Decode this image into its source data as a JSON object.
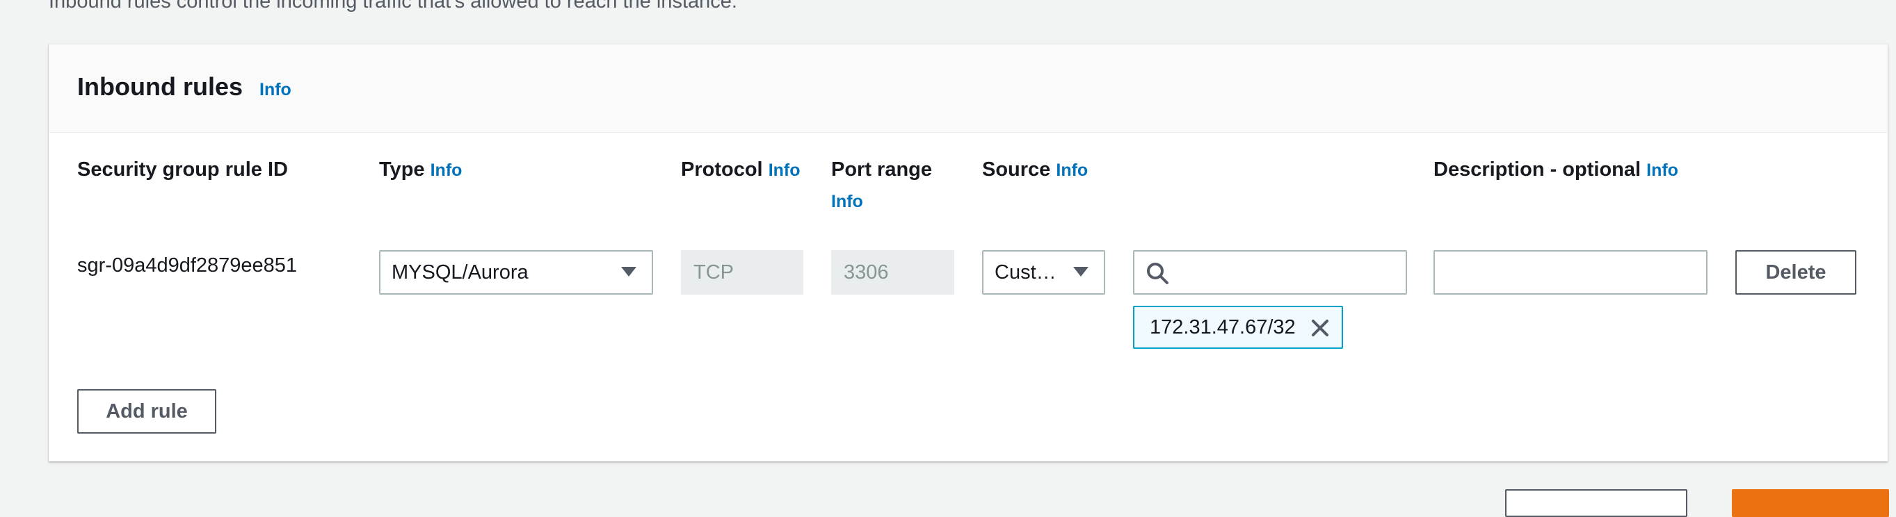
{
  "page": {
    "description": "Inbound rules control the incoming traffic that's allowed to reach the instance."
  },
  "panel": {
    "title": "Inbound rules",
    "title_info": "Info"
  },
  "columns": {
    "rule_id": "Security group rule ID",
    "type": "Type",
    "type_info": "Info",
    "protocol": "Protocol",
    "protocol_info": "Info",
    "port_range": "Port range",
    "port_range_info": "Info",
    "source": "Source",
    "source_info": "Info",
    "description": "Description - optional",
    "description_info": "Info"
  },
  "rule": {
    "id": "sgr-09a4d9df2879ee851",
    "type_value": "MYSQL/Aurora",
    "protocol_value": "TCP",
    "port_value": "3306",
    "source_value": "Cust…",
    "source_search_value": "",
    "source_token": "172.31.47.67/32",
    "description_value": "",
    "delete_label": "Delete"
  },
  "actions": {
    "add_rule_label": "Add rule"
  },
  "colors": {
    "link": "#0073bb",
    "primary": "#ec7211",
    "token_border": "#00a1c9"
  }
}
